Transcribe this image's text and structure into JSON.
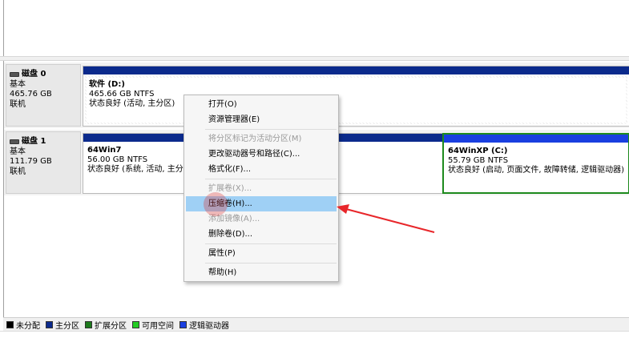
{
  "disks": [
    {
      "title": "磁盘 0",
      "type": "基本",
      "size": "465.76 GB",
      "status": "联机",
      "volumes": [
        {
          "name": "软件 (D:)",
          "size": "465.66 GB NTFS",
          "status": "状态良好 (活动, 主分区)",
          "kind": "primary"
        }
      ]
    },
    {
      "title": "磁盘 1",
      "type": "基本",
      "size": "111.79 GB",
      "status": "联机",
      "volumes": [
        {
          "name": "64Win7",
          "size": "56.00 GB NTFS",
          "status": "状态良好 (系统, 活动, 主分区)",
          "kind": "primary"
        },
        {
          "name": "64WinXP   (C:)",
          "size": "55.79 GB NTFS",
          "status": "状态良好 (启动, 页面文件, 故障转储, 逻辑驱动器)",
          "kind": "logical"
        }
      ]
    }
  ],
  "context_menu": {
    "items": [
      {
        "label": "打开(O)",
        "enabled": true
      },
      {
        "label": "资源管理器(E)",
        "enabled": true
      },
      {
        "label": "将分区标记为活动分区(M)",
        "enabled": false
      },
      {
        "label": "更改驱动器号和路径(C)...",
        "enabled": true
      },
      {
        "label": "格式化(F)...",
        "enabled": true
      },
      {
        "label": "扩展卷(X)...",
        "enabled": false
      },
      {
        "label": "压缩卷(H)...",
        "enabled": true,
        "highlighted": true
      },
      {
        "label": "添加镜像(A)...",
        "enabled": false
      },
      {
        "label": "删除卷(D)...",
        "enabled": true
      },
      {
        "label": "属性(P)",
        "enabled": true
      },
      {
        "label": "帮助(H)",
        "enabled": true
      }
    ]
  },
  "legend": [
    {
      "label": "未分配",
      "color": "#000000"
    },
    {
      "label": "主分区",
      "color": "#0b2a8c"
    },
    {
      "label": "扩展分区",
      "color": "#1d7a1d"
    },
    {
      "label": "可用空间",
      "color": "#22cc22"
    },
    {
      "label": "逻辑驱动器",
      "color": "#1a3fe0"
    }
  ],
  "annotation": {
    "color": "#e8262a"
  }
}
